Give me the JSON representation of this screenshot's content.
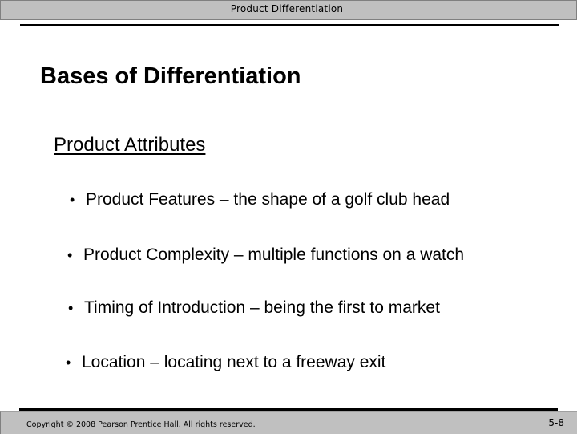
{
  "header": {
    "title": "Product Differentiation"
  },
  "slide": {
    "title": "Bases of Differentiation",
    "subheading": "Product Attributes",
    "bullet_glyph": "•",
    "bullets": [
      {
        "text": "Product Features – the shape of a golf club head"
      },
      {
        "text": "Product Complexity – multiple functions on a watch"
      },
      {
        "text": "Timing of Introduction – being the first to market"
      },
      {
        "text": "Location – locating next to a freeway exit"
      }
    ]
  },
  "footer": {
    "copyright": "Copyright © 2008 Pearson Prentice Hall. All rights reserved.",
    "page_number": "5-8"
  },
  "colors": {
    "bar_gray": "#c0c0c0",
    "rule": "#000000",
    "text": "#000000",
    "background": "#ffffff"
  }
}
